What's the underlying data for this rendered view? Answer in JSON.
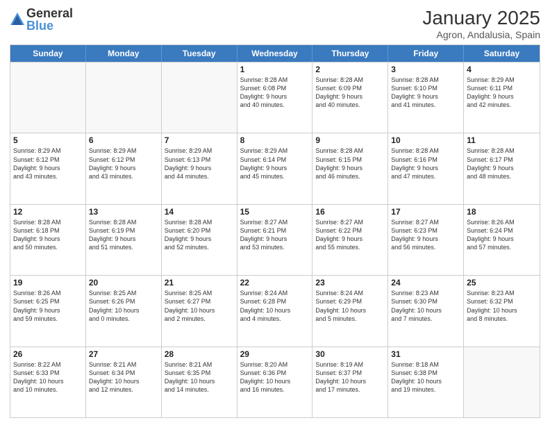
{
  "logo": {
    "general": "General",
    "blue": "Blue"
  },
  "title": "January 2025",
  "location": "Agron, Andalusia, Spain",
  "weekdays": [
    "Sunday",
    "Monday",
    "Tuesday",
    "Wednesday",
    "Thursday",
    "Friday",
    "Saturday"
  ],
  "weeks": [
    [
      {
        "day": "",
        "info": ""
      },
      {
        "day": "",
        "info": ""
      },
      {
        "day": "",
        "info": ""
      },
      {
        "day": "1",
        "info": "Sunrise: 8:28 AM\nSunset: 6:08 PM\nDaylight: 9 hours\nand 40 minutes."
      },
      {
        "day": "2",
        "info": "Sunrise: 8:28 AM\nSunset: 6:09 PM\nDaylight: 9 hours\nand 40 minutes."
      },
      {
        "day": "3",
        "info": "Sunrise: 8:28 AM\nSunset: 6:10 PM\nDaylight: 9 hours\nand 41 minutes."
      },
      {
        "day": "4",
        "info": "Sunrise: 8:29 AM\nSunset: 6:11 PM\nDaylight: 9 hours\nand 42 minutes."
      }
    ],
    [
      {
        "day": "5",
        "info": "Sunrise: 8:29 AM\nSunset: 6:12 PM\nDaylight: 9 hours\nand 43 minutes."
      },
      {
        "day": "6",
        "info": "Sunrise: 8:29 AM\nSunset: 6:12 PM\nDaylight: 9 hours\nand 43 minutes."
      },
      {
        "day": "7",
        "info": "Sunrise: 8:29 AM\nSunset: 6:13 PM\nDaylight: 9 hours\nand 44 minutes."
      },
      {
        "day": "8",
        "info": "Sunrise: 8:29 AM\nSunset: 6:14 PM\nDaylight: 9 hours\nand 45 minutes."
      },
      {
        "day": "9",
        "info": "Sunrise: 8:28 AM\nSunset: 6:15 PM\nDaylight: 9 hours\nand 46 minutes."
      },
      {
        "day": "10",
        "info": "Sunrise: 8:28 AM\nSunset: 6:16 PM\nDaylight: 9 hours\nand 47 minutes."
      },
      {
        "day": "11",
        "info": "Sunrise: 8:28 AM\nSunset: 6:17 PM\nDaylight: 9 hours\nand 48 minutes."
      }
    ],
    [
      {
        "day": "12",
        "info": "Sunrise: 8:28 AM\nSunset: 6:18 PM\nDaylight: 9 hours\nand 50 minutes."
      },
      {
        "day": "13",
        "info": "Sunrise: 8:28 AM\nSunset: 6:19 PM\nDaylight: 9 hours\nand 51 minutes."
      },
      {
        "day": "14",
        "info": "Sunrise: 8:28 AM\nSunset: 6:20 PM\nDaylight: 9 hours\nand 52 minutes."
      },
      {
        "day": "15",
        "info": "Sunrise: 8:27 AM\nSunset: 6:21 PM\nDaylight: 9 hours\nand 53 minutes."
      },
      {
        "day": "16",
        "info": "Sunrise: 8:27 AM\nSunset: 6:22 PM\nDaylight: 9 hours\nand 55 minutes."
      },
      {
        "day": "17",
        "info": "Sunrise: 8:27 AM\nSunset: 6:23 PM\nDaylight: 9 hours\nand 56 minutes."
      },
      {
        "day": "18",
        "info": "Sunrise: 8:26 AM\nSunset: 6:24 PM\nDaylight: 9 hours\nand 57 minutes."
      }
    ],
    [
      {
        "day": "19",
        "info": "Sunrise: 8:26 AM\nSunset: 6:25 PM\nDaylight: 9 hours\nand 59 minutes."
      },
      {
        "day": "20",
        "info": "Sunrise: 8:25 AM\nSunset: 6:26 PM\nDaylight: 10 hours\nand 0 minutes."
      },
      {
        "day": "21",
        "info": "Sunrise: 8:25 AM\nSunset: 6:27 PM\nDaylight: 10 hours\nand 2 minutes."
      },
      {
        "day": "22",
        "info": "Sunrise: 8:24 AM\nSunset: 6:28 PM\nDaylight: 10 hours\nand 4 minutes."
      },
      {
        "day": "23",
        "info": "Sunrise: 8:24 AM\nSunset: 6:29 PM\nDaylight: 10 hours\nand 5 minutes."
      },
      {
        "day": "24",
        "info": "Sunrise: 8:23 AM\nSunset: 6:30 PM\nDaylight: 10 hours\nand 7 minutes."
      },
      {
        "day": "25",
        "info": "Sunrise: 8:23 AM\nSunset: 6:32 PM\nDaylight: 10 hours\nand 8 minutes."
      }
    ],
    [
      {
        "day": "26",
        "info": "Sunrise: 8:22 AM\nSunset: 6:33 PM\nDaylight: 10 hours\nand 10 minutes."
      },
      {
        "day": "27",
        "info": "Sunrise: 8:21 AM\nSunset: 6:34 PM\nDaylight: 10 hours\nand 12 minutes."
      },
      {
        "day": "28",
        "info": "Sunrise: 8:21 AM\nSunset: 6:35 PM\nDaylight: 10 hours\nand 14 minutes."
      },
      {
        "day": "29",
        "info": "Sunrise: 8:20 AM\nSunset: 6:36 PM\nDaylight: 10 hours\nand 16 minutes."
      },
      {
        "day": "30",
        "info": "Sunrise: 8:19 AM\nSunset: 6:37 PM\nDaylight: 10 hours\nand 17 minutes."
      },
      {
        "day": "31",
        "info": "Sunrise: 8:18 AM\nSunset: 6:38 PM\nDaylight: 10 hours\nand 19 minutes."
      },
      {
        "day": "",
        "info": ""
      }
    ]
  ]
}
